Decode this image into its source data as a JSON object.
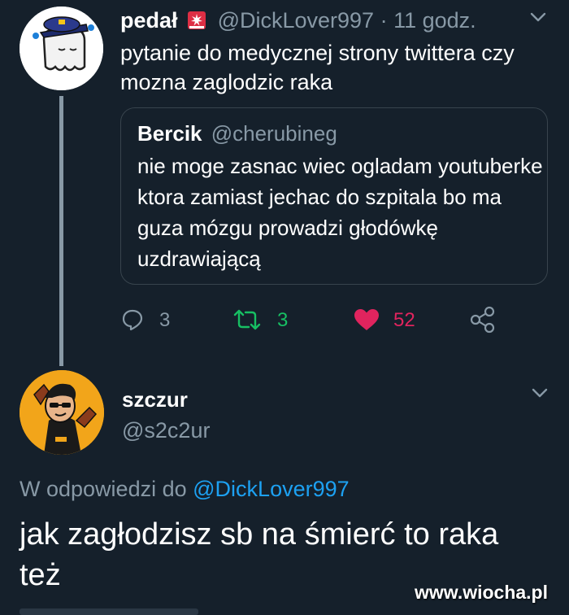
{
  "colors": {
    "background": "#15202b",
    "text_primary": "#ffffff",
    "text_secondary": "#8899a6",
    "link": "#1da1f2",
    "retweet": "#17bf63",
    "like": "#e0245e",
    "border": "#38444d"
  },
  "tweet1": {
    "display_name": "pedał",
    "badge_icon": "police-siren-emoji",
    "handle": "@DickLover997",
    "separator": "·",
    "time": "11 godz.",
    "text": "pytanie do medycznej strony twittera czy mozna zaglodzic raka",
    "quote": {
      "display_name": "Bercik",
      "handle": "@cherubineg",
      "text": "nie moge zasnac wiec ogladam youtuberke ktora zamiast jechac do szpitala bo ma guza mózgu prowadzi głodówkę uzdrawiającą"
    },
    "actions": {
      "replies": "3",
      "retweets": "3",
      "likes": "52"
    }
  },
  "tweet2": {
    "display_name": "szczur",
    "handle": "@s2c2ur",
    "reply_prefix": "W odpowiedzi do",
    "reply_mention": "@DickLover997",
    "text": "jak zagłodzisz sb na śmierć to raka też"
  },
  "watermark": "www.wiocha.pl"
}
